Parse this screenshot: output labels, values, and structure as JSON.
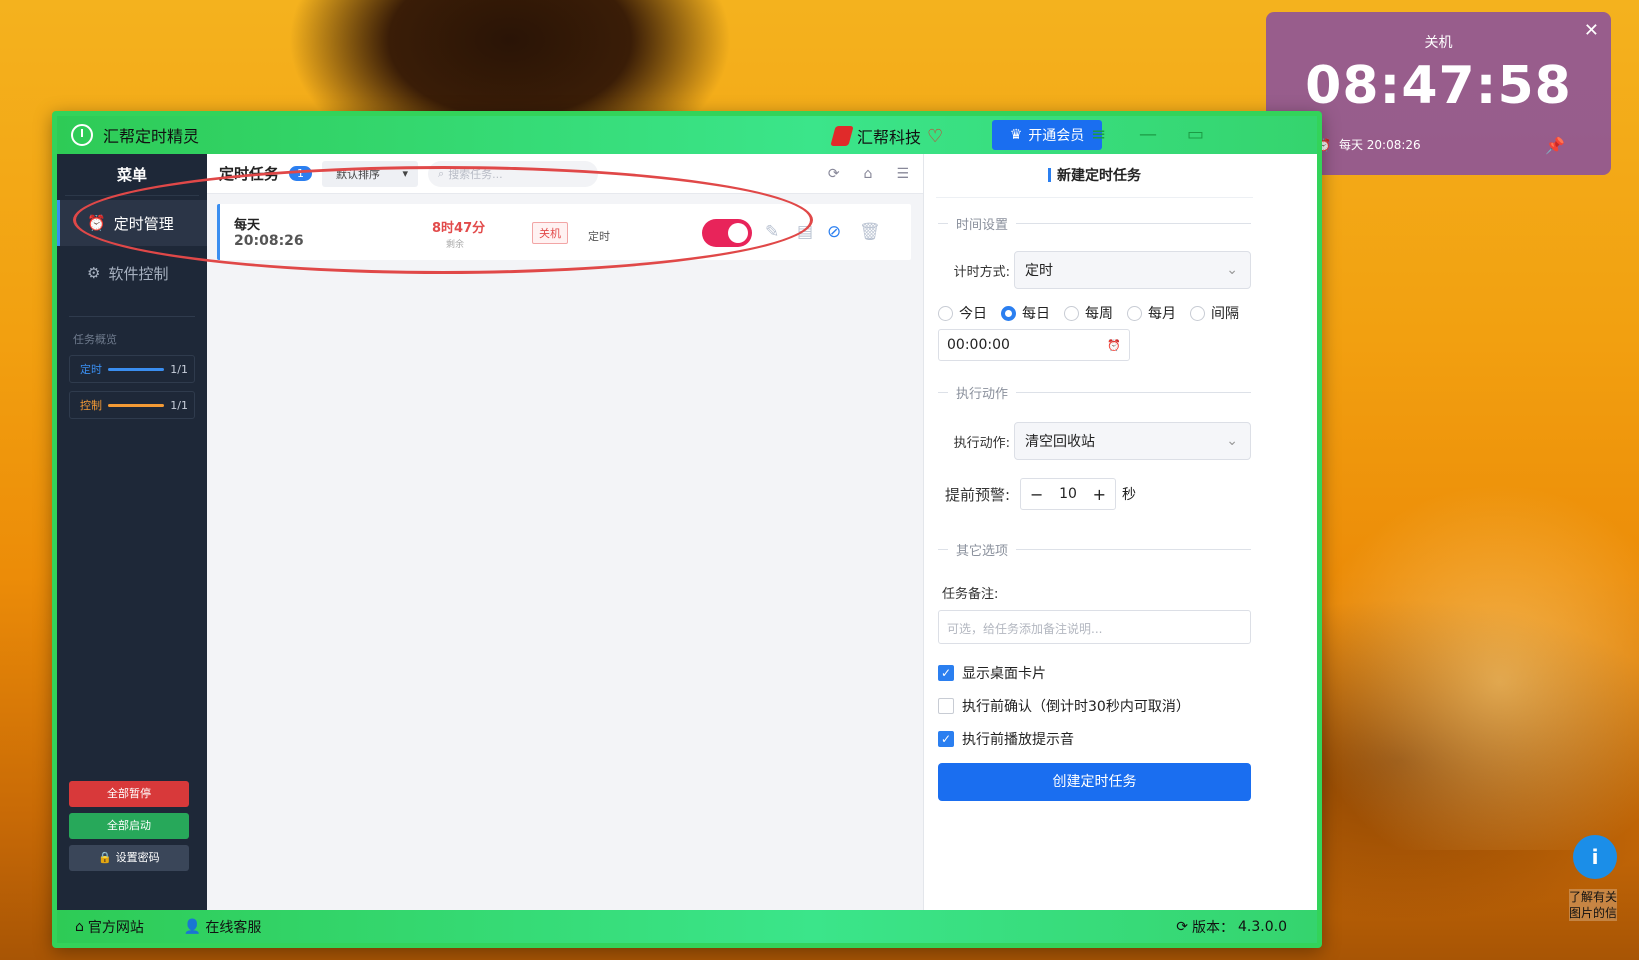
{
  "app": {
    "title": "汇帮定时精灵",
    "brand": "汇帮科技",
    "vip_label": "开通会员",
    "controls": {
      "menu": "≡",
      "minimize": "—",
      "maximize": "▭"
    }
  },
  "sidebar": {
    "header": "菜单",
    "items": [
      {
        "label": "定时管理",
        "icon": "alarm-clock-icon",
        "active": true
      },
      {
        "label": "软件控制",
        "icon": "gear-icon",
        "active": false
      }
    ],
    "overview_title": "任务概览",
    "stats": [
      {
        "label": "定时",
        "value": "1/1",
        "color": "#3a8ef0"
      },
      {
        "label": "控制",
        "value": "1/1",
        "color": "#f39a35"
      }
    ],
    "buttons": {
      "pause_all": "全部暂停",
      "start_all": "全部启动",
      "set_password": "设置密码"
    }
  },
  "main": {
    "title": "定时任务",
    "count": "1",
    "sort_label": "默认排序",
    "search_placeholder": "搜索任务...",
    "task": {
      "frequency": "每天",
      "time": "20:08:26",
      "remaining": "8时47分",
      "remaining_label": "剩余",
      "action": "关机",
      "type": "定时",
      "enabled": true
    }
  },
  "panel": {
    "title": "新建定时任务",
    "sections": {
      "time": "时间设置",
      "action": "执行动作",
      "other": "其它选项"
    },
    "timing_label": "计时方式:",
    "timing_value": "定时",
    "radios": [
      {
        "label": "今日",
        "selected": false
      },
      {
        "label": "每日",
        "selected": true
      },
      {
        "label": "每周",
        "selected": false
      },
      {
        "label": "每月",
        "selected": false
      },
      {
        "label": "间隔",
        "selected": false
      }
    ],
    "time_value": "00:00:00",
    "action_label": "执行动作:",
    "action_value": "清空回收站",
    "warn_label": "提前预警:",
    "warn_value": "10",
    "warn_unit": "秒",
    "note_label": "任务备注:",
    "note_placeholder": "可选，给任务添加备注说明...",
    "checks": [
      {
        "label": "显示桌面卡片",
        "checked": true
      },
      {
        "label": "执行前确认（倒计时30秒内可取消）",
        "checked": false
      },
      {
        "label": "执行前播放提示音",
        "checked": true
      }
    ],
    "create_button": "创建定时任务"
  },
  "statusbar": {
    "website": "官方网站",
    "support": "在线客服",
    "version_label": "版本：",
    "version": "4.3.0.0"
  },
  "card": {
    "title": "关机",
    "clock": "08:47:58",
    "subtitle": "每天 20:08:26"
  },
  "desktop_widget": {
    "line1": "了解有关",
    "line2": "图片的信"
  },
  "colors": {
    "window_border": "#33d35a",
    "accent": "#1a6ef0",
    "toggle_on": "#e8245a",
    "danger": "#e24b4b",
    "card_bg": "#8f5696"
  }
}
